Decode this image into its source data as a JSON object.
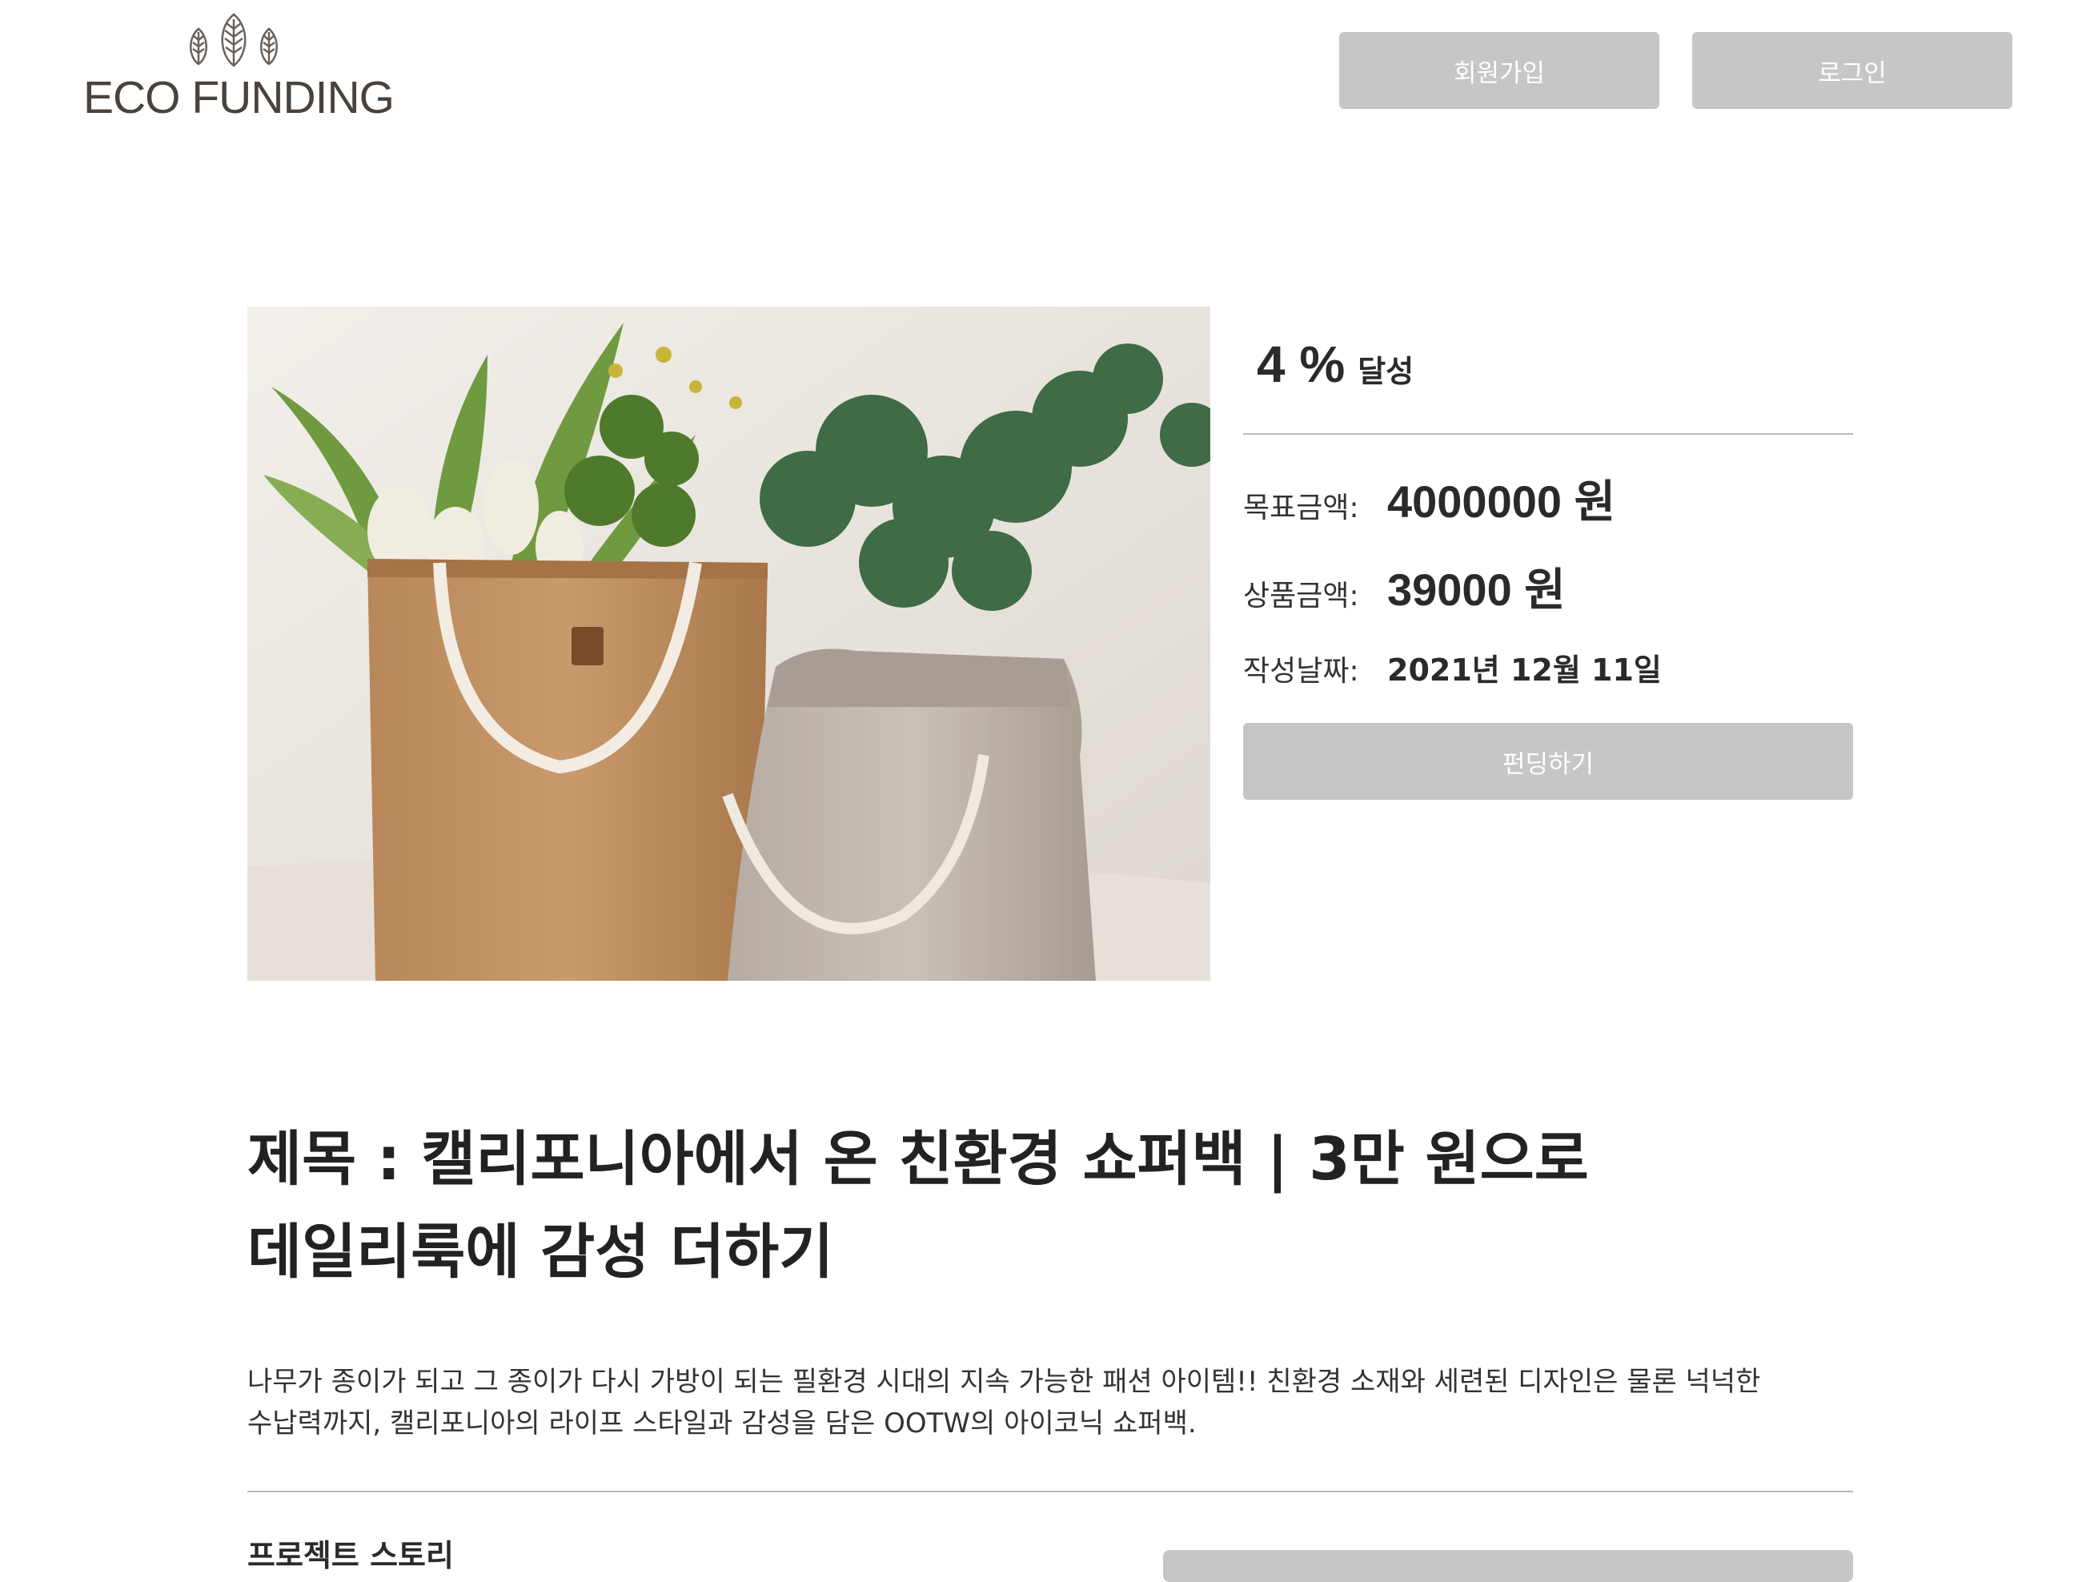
{
  "header": {
    "logo_text": "ECO FUNDING",
    "signup_label": "회원가입",
    "login_label": "로그인"
  },
  "product": {
    "image_alt": "",
    "achievement_value": "4 %",
    "achievement_label": "달성",
    "goal_label": "목표금액:",
    "goal_value": "4000000 원",
    "price_label": "상품금액:",
    "price_value": "39000 원",
    "date_label": "작성날짜:",
    "date_value": "2021년 12월 11일",
    "fund_button_label": "펀딩하기",
    "progress_percent": 4
  },
  "content": {
    "title_line1": "제목 : 캘리포니아에서 온 친환경 쇼퍼백 | 3만 원으로",
    "title_line2": "데일리룩에 감성 더하기",
    "description_line1": "나무가 종이가 되고 그 종이가 다시 가방이 되는 필환경 시대의 지속 가능한 패션 아이템!! 친환경 소재와 세련된 디자인은 물론 넉넉한",
    "description_line2": "수납력까지, 캘리포니아의 라이프 스타일과 감성을 담은 OOTW의 아이코닉 쇼퍼백.",
    "story_heading": "프로젝트 스토리"
  },
  "colors": {
    "button_gray": "#c6c6c6",
    "text_dark": "#222222",
    "divider": "#b9b9b9"
  }
}
